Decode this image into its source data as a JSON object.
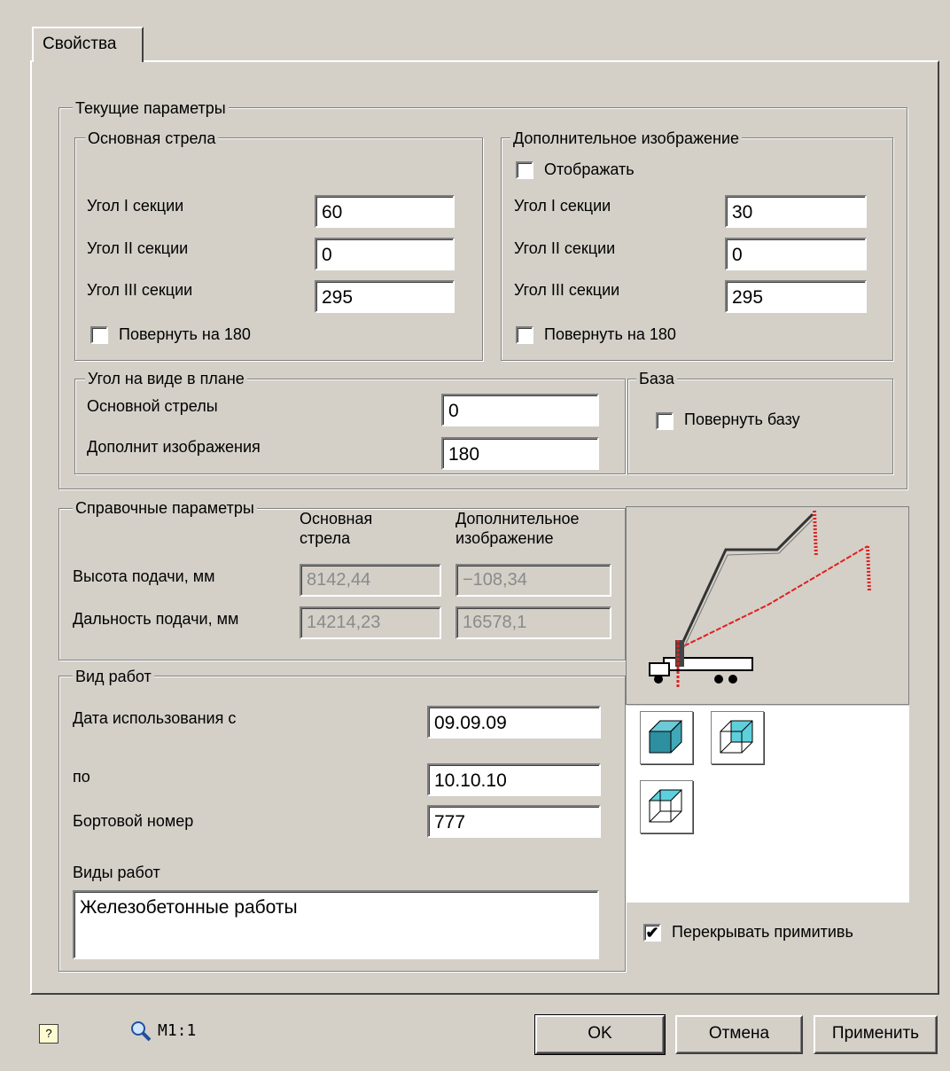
{
  "tab": {
    "label": "Свойства"
  },
  "current": {
    "legend": "Текущие параметры",
    "main_boom": {
      "legend": "Основная стрела",
      "angle1_label": "Угол I секции",
      "angle1_value": "60",
      "angle2_label": "Угол II секции",
      "angle2_value": "0",
      "angle3_label": "Угол III секции",
      "angle3_value": "295",
      "rotate_label": "Повернуть на 180",
      "rotate_checked": false
    },
    "extra_image": {
      "legend": "Дополнительное изображение",
      "show_label": "Отображать",
      "show_checked": false,
      "angle1_label": "Угол I  секции",
      "angle1_value": "30",
      "angle2_label": "Угол II секции",
      "angle2_value": "0",
      "angle3_label": "Угол III секции",
      "angle3_value": "295",
      "rotate_label": "Повернуть на 180",
      "rotate_checked": false
    },
    "plan_angle": {
      "legend": "Угол на виде в плане",
      "main_label": "Основной стрелы",
      "main_value": "0",
      "extra_label": "Дополнит изображения",
      "extra_value": "180"
    },
    "base": {
      "legend": "База",
      "rotate_label": "Повернуть  базу",
      "rotate_checked": false
    }
  },
  "reference": {
    "legend": "Справочные параметры",
    "col_main": "Основная стрела",
    "col_extra": "Дополнительное изображение",
    "height_label": "Высота подачи, мм",
    "height_main": "8142,44",
    "height_extra": "−108,34",
    "range_label": "Дальность подачи, мм",
    "range_main": "14214,23",
    "range_extra": "16578,1"
  },
  "work": {
    "legend": "Вид работ",
    "date_from_label": "Дата использования с",
    "date_from_value": "09.09.09",
    "date_to_label": "по",
    "date_to_value": "10.10.10",
    "board_label": "Бортовой номер",
    "board_value": "777",
    "types_label": "Виды работ",
    "types_value": "Железобетонные работы"
  },
  "view_buttons": [
    "cube-shaded-icon",
    "cube-cyan-face-icon",
    "cube-cyan-top-icon"
  ],
  "overlap": {
    "label": "Перекрывать примитивь",
    "checked": true
  },
  "footer": {
    "scale": "M1:1",
    "ok": "OK",
    "cancel": "Отмена",
    "apply": "Применить"
  },
  "colors": {
    "window": "#d4d0c8",
    "boom_main": "#000000",
    "boom_extra": "#e02020",
    "cube_cyan": "#40c0d0"
  }
}
